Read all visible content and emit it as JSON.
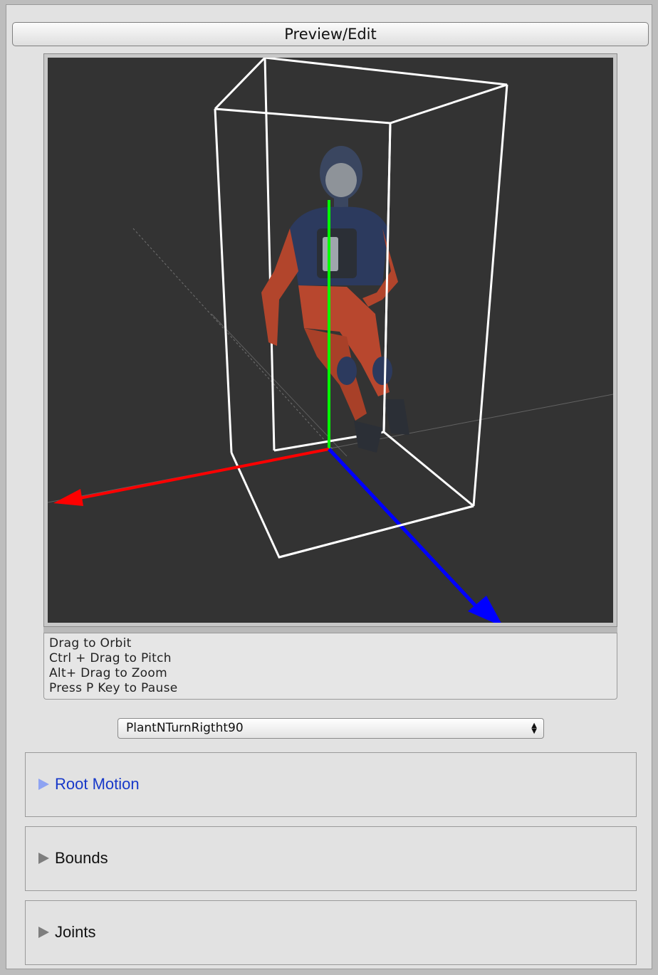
{
  "toolbar": {
    "preview_edit_label": "Preview/Edit"
  },
  "viewport": {
    "colors": {
      "background": "#333333",
      "x_axis": "#ff0000",
      "y_axis": "#00ff00",
      "z_axis": "#0000ff",
      "bounds_box": "#ffffff"
    }
  },
  "help": {
    "lines": [
      "Drag to Orbit",
      "Ctrl + Drag to Pitch",
      "Alt+ Drag to Zoom",
      "Press P Key to Pause"
    ]
  },
  "clip_select": {
    "value": "PlantNTurnRigtht90",
    "arrow_icon": "up-down-arrows-icon"
  },
  "foldouts": [
    {
      "label": "Root Motion",
      "expanded": false,
      "highlighted": true
    },
    {
      "label": "Bounds",
      "expanded": false,
      "highlighted": false
    },
    {
      "label": "Joints",
      "expanded": false,
      "highlighted": false
    }
  ]
}
